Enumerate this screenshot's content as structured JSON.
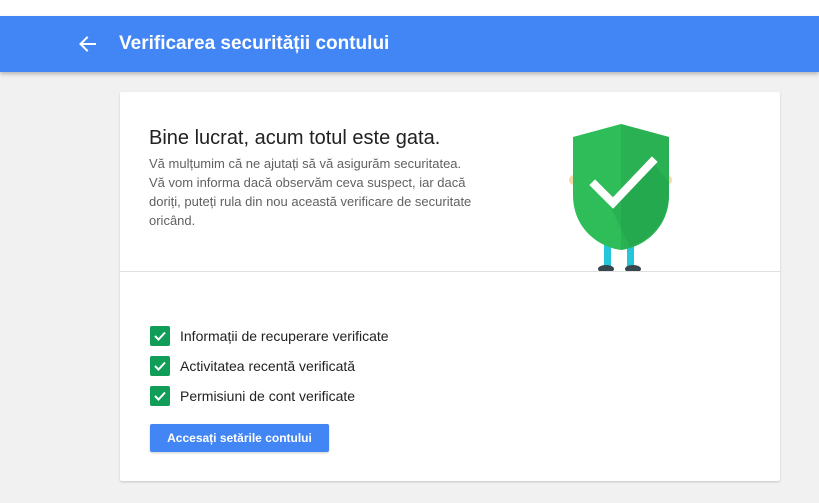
{
  "header": {
    "title": "Verificarea securității contului",
    "back_icon": "arrow-back-icon"
  },
  "card": {
    "headline": "Bine lucrat, acum totul este gata.",
    "description": "Vă mulțumim că ne ajutați să vă asigurăm securitatea. Vă vom informa dacă observăm ceva suspect, iar dacă doriți, puteți rula din nou această verificare de securitate oricând.",
    "illustration_icon": "shield-check-icon",
    "checklist": [
      {
        "label": "Informații de recuperare verificate",
        "checked": true
      },
      {
        "label": "Activitatea recentă verificată",
        "checked": true
      },
      {
        "label": "Permisiuni de cont verificate",
        "checked": true
      }
    ],
    "action_label": "Accesați setările contului"
  },
  "colors": {
    "header_bg": "#4285f4",
    "page_bg": "#f1f1f1",
    "check_green": "#0f9d58",
    "shield_green": "#2ebd59",
    "button_bg": "#4285f4"
  }
}
